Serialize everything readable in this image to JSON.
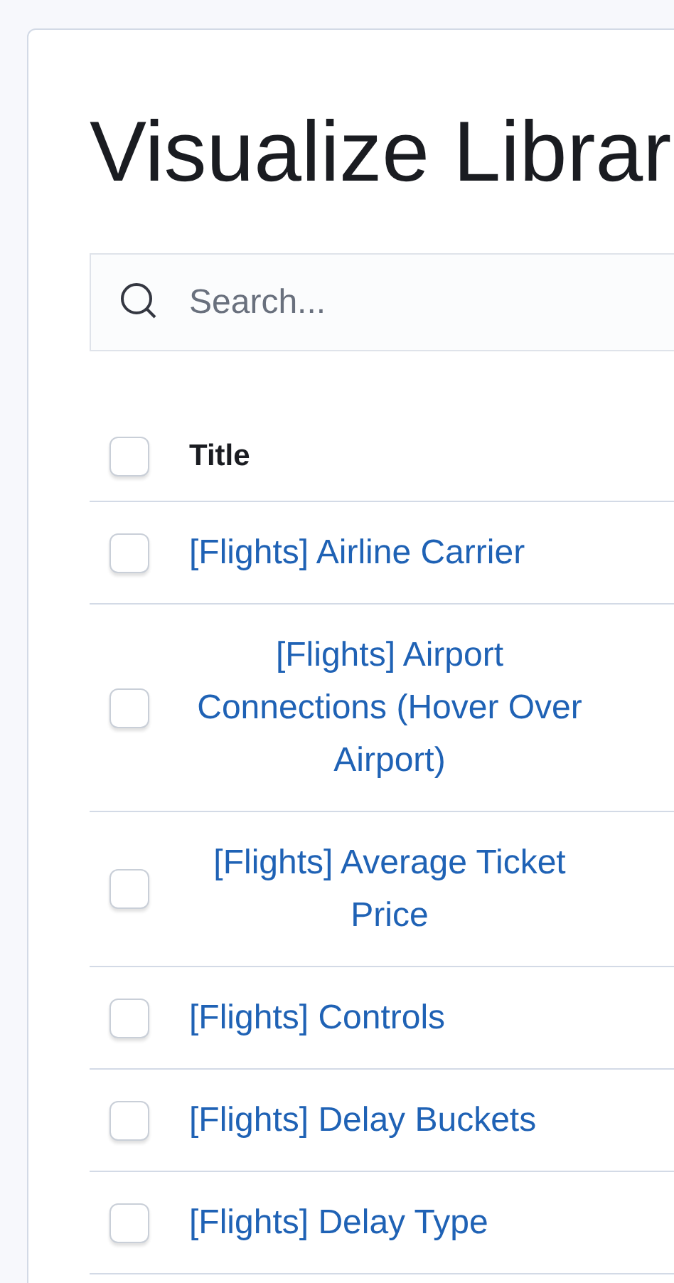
{
  "page": {
    "title": "Visualize Librar"
  },
  "search": {
    "placeholder": "Search..."
  },
  "table": {
    "select_all": {
      "checked": false
    },
    "columns": [
      "Title"
    ],
    "rows": [
      {
        "title": "[Flights] Airline Carrier",
        "checked": false
      },
      {
        "title": "[Flights] Airport Connections (Hover Over Airport)",
        "checked": false
      },
      {
        "title": "[Flights] Average Ticket Price",
        "checked": false
      },
      {
        "title": "[Flights] Controls",
        "checked": false
      },
      {
        "title": "[Flights] Delay Buckets",
        "checked": false
      },
      {
        "title": "[Flights] Delay Type",
        "checked": false
      }
    ]
  }
}
